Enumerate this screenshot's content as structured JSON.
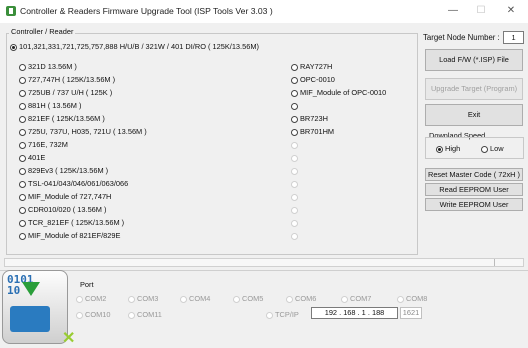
{
  "window": {
    "title": "Controller & Readers Firmware Upgrade Tool  (ISP Tools Ver 3.03 )",
    "min": "—",
    "max": "☐",
    "close": "✕"
  },
  "reader_group": {
    "title": "Controller / Reader",
    "top_option": "101,321,331,721,725,757,888 H/U/B / 321W / 401 DI/RO   ( 125K/13.56M)",
    "left_options": [
      "321D           13.56M )",
      "727,747H   ( 125K/13.56M )",
      "725UB / 737 U/H    ( 125K           )",
      "881H          (           13.56M )",
      "821EF      ( 125K/13.56M )",
      "725U, 737U, H035, 721U  (          13.56M )",
      "716E, 732M",
      "401E",
      "829Ev3          ( 125K/13.56M )",
      "TSL-041/043/046/061/063/066",
      "MIF_Module of  727,747H",
      "CDR010/020   (          13.56M )",
      "TCR_821EF         ( 125K/13.56M )",
      "MIF_Module of 821EF/829E"
    ],
    "right_options": [
      "RAY727H",
      "OPC-0010",
      "MIF_Module of OPC-0010",
      "",
      "BR723H",
      "BR701HM"
    ]
  },
  "target": {
    "label": "Target Node Number :",
    "value": "1"
  },
  "buttons": {
    "load": "Load  F/W (*.ISP)  File",
    "upgrade": "Upgrade Target  (Program)",
    "exit": "Exit",
    "reset": "Reset Master Code  ( 72xH )",
    "read": "Read EEPROM User",
    "write": "Write EEPROM User"
  },
  "speed": {
    "label": "Downlaod Speed",
    "high": "High",
    "low": "Low"
  },
  "port": {
    "label": "Port",
    "row1": [
      "COM2",
      "COM3",
      "COM4",
      "COM5",
      "COM6",
      "COM7",
      "COM8"
    ],
    "row2": [
      "COM10",
      "COM11"
    ],
    "tcpip": "TCP/IP",
    "ip": "192 . 168 .  1  . 188",
    "tcp_port": "1621"
  }
}
